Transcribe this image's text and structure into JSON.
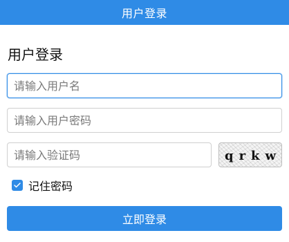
{
  "header": {
    "title": "用户登录"
  },
  "form": {
    "title": "用户登录",
    "username": {
      "placeholder": "请输入用户名",
      "value": ""
    },
    "password": {
      "placeholder": "请输入用户密码",
      "value": ""
    },
    "captcha": {
      "placeholder": "请输入验证码",
      "value": "",
      "image_chars": [
        "q",
        "r",
        "k",
        "w"
      ]
    },
    "remember": {
      "label": "记住密码",
      "checked": true
    },
    "submit_label": "立即登录"
  },
  "colors": {
    "brand": "#2f8be6"
  },
  "icons": {
    "checkbox_checked": "check-icon"
  }
}
